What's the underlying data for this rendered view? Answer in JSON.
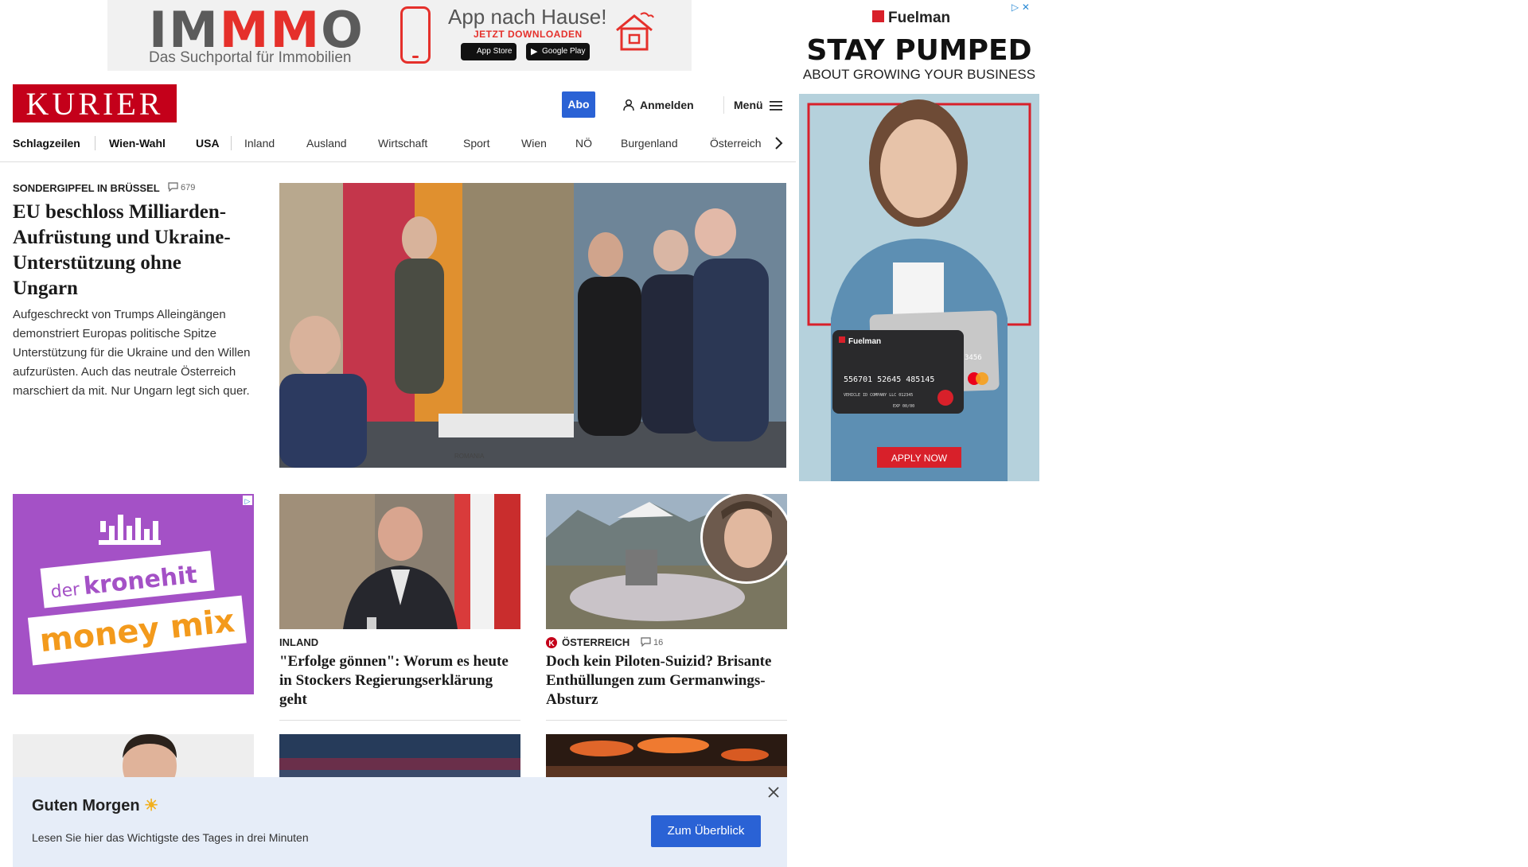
{
  "top_ad": {
    "brand_im": "IM",
    "brand_mm": "MM",
    "brand_o": "O",
    "tagline": "Das Suchportal für Immobilien",
    "headline": "App nach Hause!",
    "subline": "JETZT DOWNLOADEN",
    "app_store": "App Store",
    "google_play": "Google Play"
  },
  "header": {
    "logo": "KURIER",
    "abo": "Abo",
    "login": "Anmelden",
    "menu": "Menü"
  },
  "nav": {
    "items": [
      "Schlagzeilen",
      "Wien-Wahl",
      "USA",
      "Inland",
      "Ausland",
      "Wirtschaft",
      "Sport",
      "Wien",
      "NÖ",
      "Burgenland",
      "Österreich"
    ]
  },
  "lead": {
    "kicker": "SONDERGIPFEL IN BRÜSSEL",
    "comments": "679",
    "title": "EU beschloss Milliarden-Aufrüstung und Ukraine-Unterstützung ohne Ungarn",
    "teaser": "Aufgeschreckt von Trumps Alleingängen demonstriert Europas politische Spitze Unterstützung für die Ukraine und den Willen aufzurüsten. Auch das neutrale Österreich marschiert da mit. Nur Ungarn legt sich quer.",
    "image_label": "ROMANIA"
  },
  "side_ad": {
    "brand": "Fuelman",
    "headline": "STAY PUMPED",
    "subline": "ABOUT GROWING YOUR BUSINESS",
    "card_brand": "Fuelman",
    "card_number": "556701 52645 485145",
    "card_holder": "VEHICLE ID COMPANY LLC 012345",
    "card_exp": "EXP 00/00",
    "card_last": "3456",
    "cta": "APPLY NOW"
  },
  "kronehit_ad": {
    "line1a": "der",
    "line1b": "kronehit",
    "line2": "money mix"
  },
  "cards": [
    {
      "kicker": "INLAND",
      "title": "\"Erfolge gönnen\": Worum es heute in Stockers Regierungserklärung geht"
    },
    {
      "kicker": "ÖSTERREICH",
      "comments": "16",
      "title": "Doch kein Piloten-Suizid? Brisante Enthüllungen zum Germanwings-Absturz"
    }
  ],
  "morning": {
    "title": "Guten Morgen",
    "text": "Lesen Sie hier das Wichtigste des Tages in drei Minuten",
    "button": "Zum Überblick"
  },
  "colors": {
    "brand_red": "#c4001a",
    "accent_blue": "#2a62d5",
    "overlay_bg": "#e6edf8"
  }
}
